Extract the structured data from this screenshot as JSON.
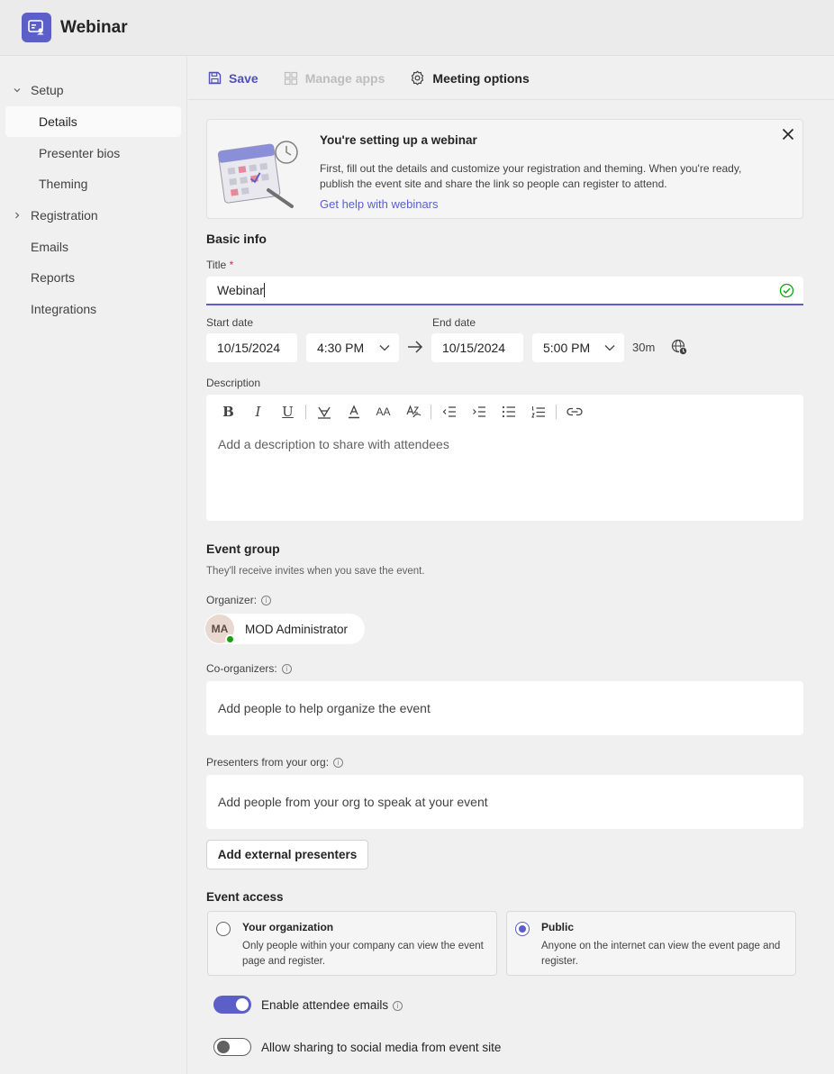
{
  "app": {
    "title": "Webinar"
  },
  "sidebar": {
    "items": [
      {
        "label": "Setup"
      },
      {
        "label": "Details"
      },
      {
        "label": "Presenter bios"
      },
      {
        "label": "Theming"
      },
      {
        "label": "Registration"
      },
      {
        "label": "Emails"
      },
      {
        "label": "Reports"
      },
      {
        "label": "Integrations"
      }
    ]
  },
  "toolbar": {
    "save_label": "Save",
    "manage_apps_label": "Manage apps",
    "meeting_options_label": "Meeting options"
  },
  "banner": {
    "title": "You're setting up a webinar",
    "text": "First, fill out the details and customize your registration and theming. When you're ready, publish the event site and share the link so people can register to attend.",
    "link": "Get help with webinars"
  },
  "basic_info": {
    "heading": "Basic info",
    "title_label": "Title",
    "title_required_mark": "*",
    "title_value": "Webinar",
    "start_date_label": "Start date",
    "end_date_label": "End date",
    "start_date": "10/15/2024",
    "start_time": "4:30 PM",
    "end_date": "10/15/2024",
    "end_time": "5:00 PM",
    "duration": "30m",
    "description_label": "Description",
    "description_placeholder": "Add a description to share with attendees"
  },
  "rte": {
    "bold": "B",
    "italic": "I",
    "underline": "U",
    "font_size": "AA"
  },
  "event_group": {
    "heading": "Event group",
    "subtext": "They'll receive invites when you save the event.",
    "organizer_label": "Organizer:",
    "organizer_initials": "MA",
    "organizer_name": "MOD Administrator",
    "coorganizers_label": "Co-organizers:",
    "coorganizers_placeholder": "Add people to help organize the event",
    "presenters_label": "Presenters from your org:",
    "presenters_placeholder": "Add people from your org to speak at your event",
    "external_button": "Add external presenters"
  },
  "event_access": {
    "heading": "Event access",
    "options": [
      {
        "title": "Your organization",
        "desc": "Only people within your company can view the event page and register.",
        "selected": false
      },
      {
        "title": "Public",
        "desc": "Anyone on the internet can view the event page and register.",
        "selected": true
      }
    ]
  },
  "toggles": {
    "attendee_emails_label": "Enable attendee emails",
    "attendee_emails_on": true,
    "social_sharing_label": "Allow sharing to social media from event site",
    "social_sharing_on": false
  },
  "colors": {
    "accent": "#5b5fc7",
    "success": "#13a10e",
    "required": "#c4314b"
  }
}
